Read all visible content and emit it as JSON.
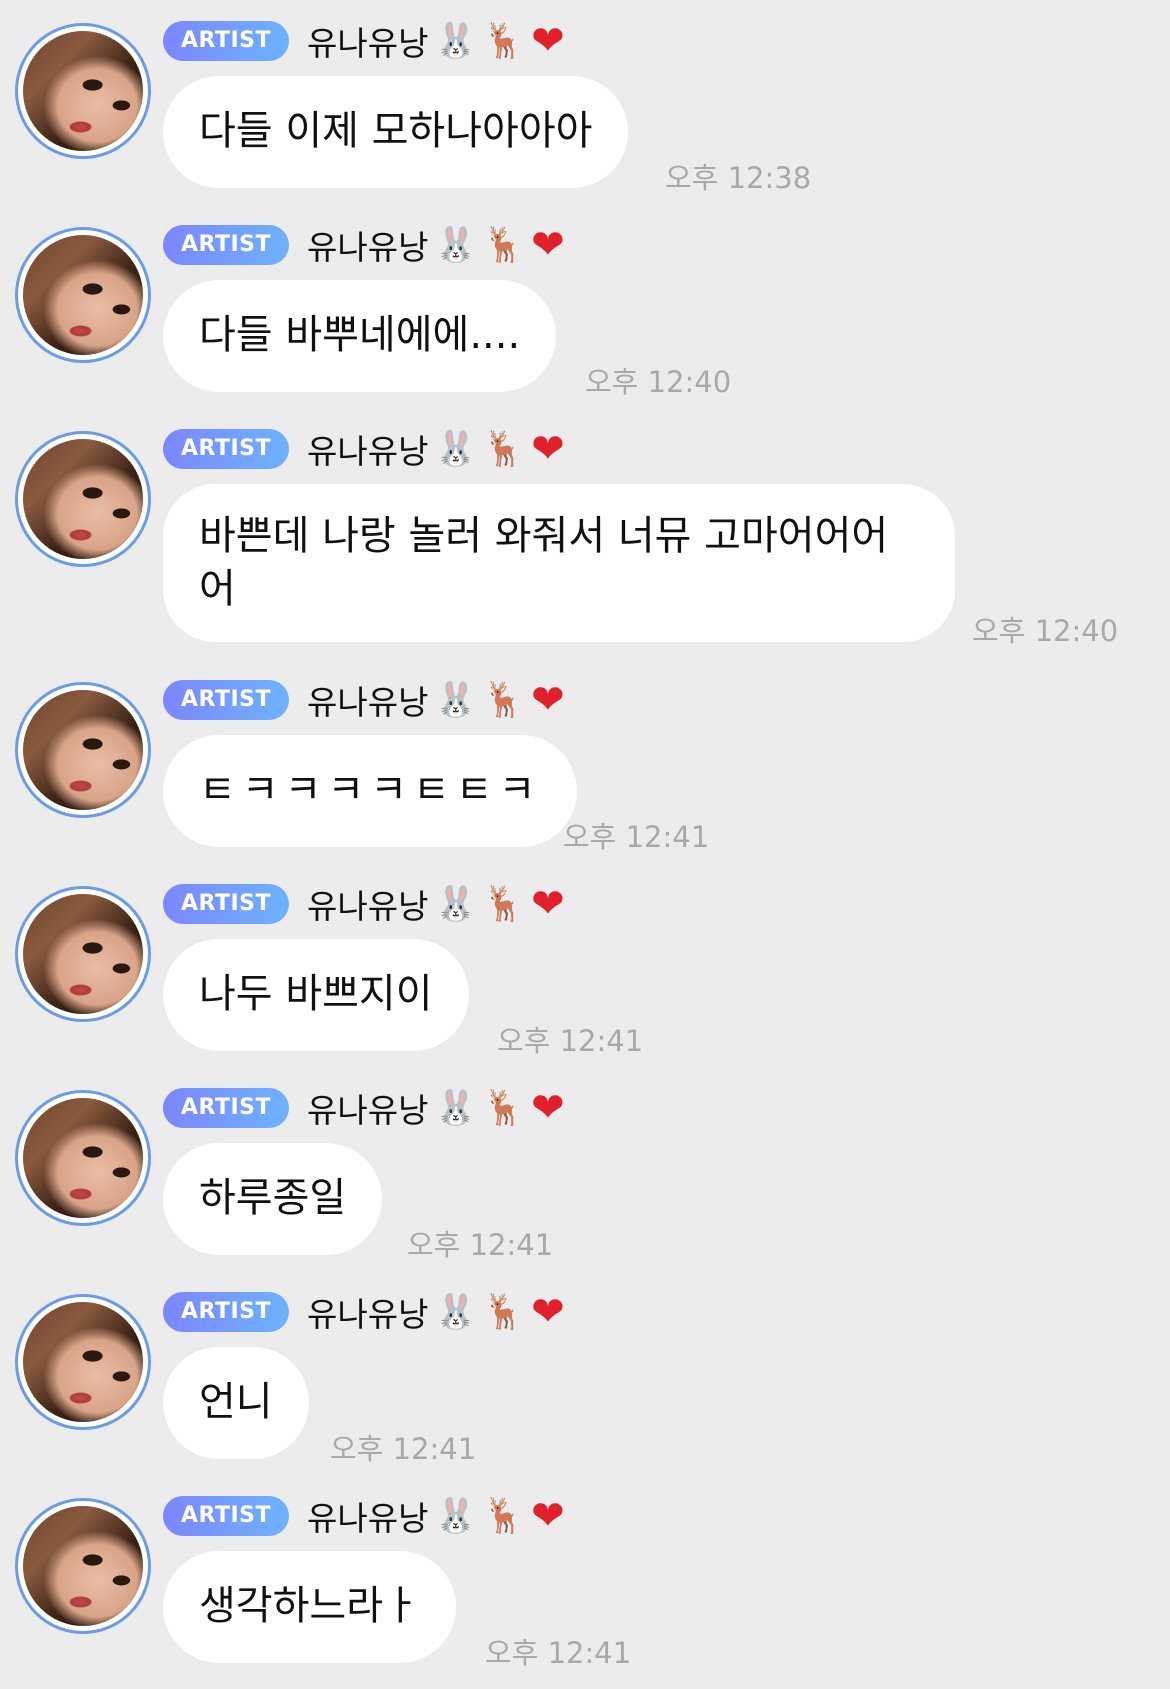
{
  "badge_label": "ARTIST",
  "sender_name": "유나유낭",
  "name_emojis": [
    "🐰",
    "🦌",
    "❤"
  ],
  "messages": [
    {
      "text": "다들 이제 모하나아아아",
      "time": "오후 12:38"
    },
    {
      "text": "다들 바뿌네에에....",
      "time": "오후 12:40"
    },
    {
      "text": "바쁜데 나랑 놀러 와줘서 너뮤 고마어어어어",
      "time": "오후 12:40"
    },
    {
      "text": "ㅌㅋㅋㅋㅋㅌㅌㅋ",
      "time": "오후 12:41"
    },
    {
      "text": "나두 바쁘지이",
      "time": "오후 12:41"
    },
    {
      "text": "하루종일",
      "time": "오후 12:41"
    },
    {
      "text": "언니",
      "time": "오후 12:41"
    },
    {
      "text": "생각하느라ㅏ",
      "time": "오후 12:41"
    }
  ]
}
